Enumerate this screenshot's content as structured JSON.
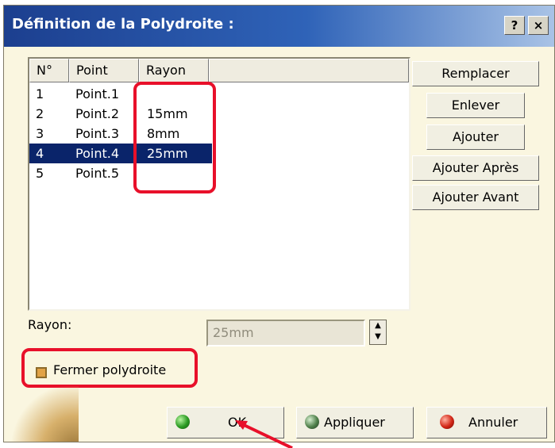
{
  "dialog": {
    "title": "Définition de la Polydroite :",
    "help_label": "?",
    "close_label": "×"
  },
  "table": {
    "headers": [
      "N°",
      "Point",
      "Rayon"
    ],
    "rows": [
      {
        "num": "1",
        "point": "Point.1",
        "rayon": ""
      },
      {
        "num": "2",
        "point": "Point.2",
        "rayon": "15mm"
      },
      {
        "num": "3",
        "point": "Point.3",
        "rayon": "8mm"
      },
      {
        "num": "4",
        "point": "Point.4",
        "rayon": "25mm",
        "selected": true
      },
      {
        "num": "5",
        "point": "Point.5",
        "rayon": ""
      }
    ]
  },
  "side_buttons": {
    "replace": "Remplacer",
    "remove": "Enlever",
    "add": "Ajouter",
    "add_after": "Ajouter Après",
    "add_before": "Ajouter Avant"
  },
  "rayon_field": {
    "label": "Rayon:",
    "value": "25mm"
  },
  "close_checkbox": {
    "label": "Fermer polydroite",
    "checked": true
  },
  "footer": {
    "ok": "OK",
    "apply": "Appliquer",
    "cancel": "Annuler"
  },
  "colors": {
    "highlight": "#e8102a",
    "selection": "#0a246a",
    "title_bar": "#2f63b8"
  }
}
